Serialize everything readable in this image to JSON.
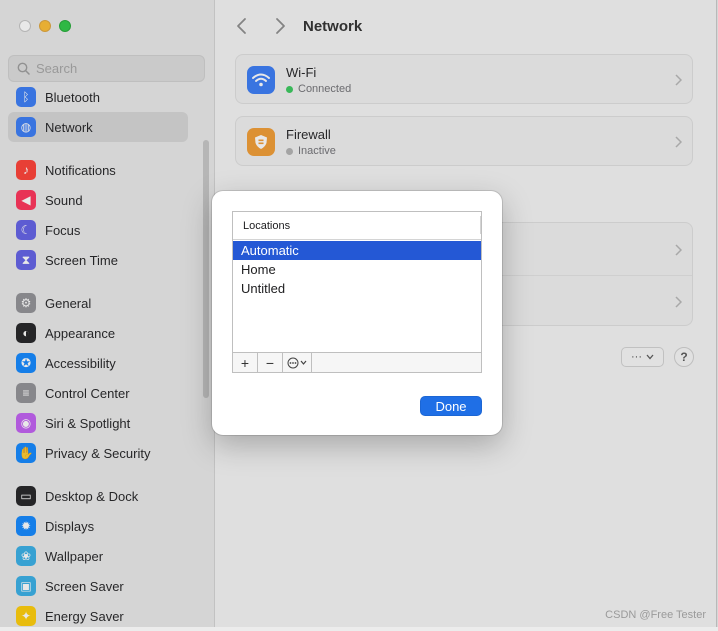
{
  "sidebar": {
    "search_placeholder": "Search",
    "items": [
      {
        "label": "Bluetooth",
        "icon": "bluetooth-icon",
        "color": "#3478f6"
      },
      {
        "label": "Network",
        "icon": "globe-icon",
        "color": "#3478f6",
        "selected": true
      },
      {
        "label": "Notifications",
        "icon": "bell-icon",
        "color": "#ff3b30"
      },
      {
        "label": "Sound",
        "icon": "speaker-icon",
        "color": "#ff2d55"
      },
      {
        "label": "Focus",
        "icon": "moon-icon",
        "color": "#5e5ce6"
      },
      {
        "label": "Screen Time",
        "icon": "hourglass-icon",
        "color": "#5e5ce6"
      },
      {
        "label": "General",
        "icon": "gear-icon",
        "color": "#8e8e93"
      },
      {
        "label": "Appearance",
        "icon": "appearance-icon",
        "color": "#1d1d1f"
      },
      {
        "label": "Accessibility",
        "icon": "accessibility-icon",
        "color": "#0a84ff"
      },
      {
        "label": "Control Center",
        "icon": "control-center-icon",
        "color": "#8e8e93"
      },
      {
        "label": "Siri & Spotlight",
        "icon": "siri-icon",
        "color": "#bf5af2"
      },
      {
        "label": "Privacy & Security",
        "icon": "hand-icon",
        "color": "#0a84ff"
      },
      {
        "label": "Desktop & Dock",
        "icon": "dock-icon",
        "color": "#1d1d1f"
      },
      {
        "label": "Displays",
        "icon": "displays-icon",
        "color": "#0a84ff"
      },
      {
        "label": "Wallpaper",
        "icon": "wallpaper-icon",
        "color": "#32ade6"
      },
      {
        "label": "Screen Saver",
        "icon": "screen-saver-icon",
        "color": "#32ade6"
      },
      {
        "label": "Energy Saver",
        "icon": "lightbulb-icon",
        "color": "#ffcc00"
      }
    ]
  },
  "header": {
    "title": "Network"
  },
  "services": [
    {
      "title": "Wi-Fi",
      "status": "Connected",
      "status_color": "#34c759",
      "icon": "wifi-icon",
      "icon_color": "#3478f6"
    },
    {
      "title": "Firewall",
      "status": "Inactive",
      "status_color": "#b0b0b0",
      "icon": "firewall-icon",
      "icon_color": "#f29a2e"
    }
  ],
  "footer": {
    "more_label": "···",
    "help_label": "?"
  },
  "locations_sheet": {
    "header": "Locations",
    "items": [
      "Automatic",
      "Home",
      "Untitled"
    ],
    "selected_index": 0,
    "add_label": "+",
    "remove_label": "−",
    "done_label": "Done"
  },
  "watermark": "CSDN @Free Tester"
}
